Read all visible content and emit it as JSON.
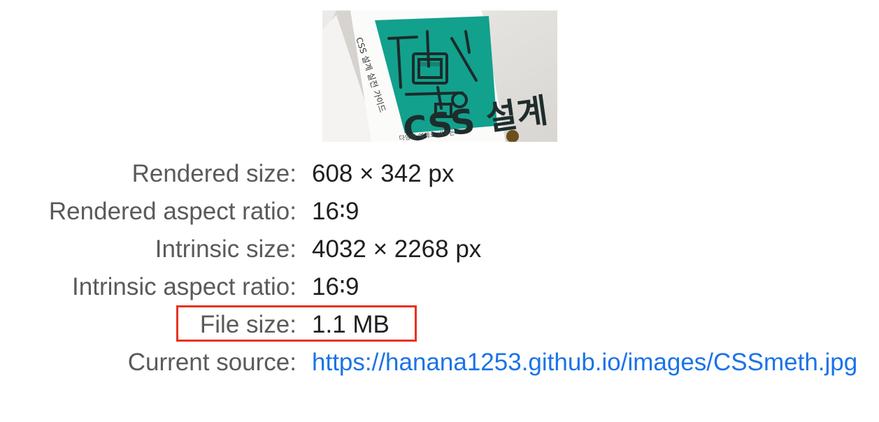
{
  "image_preview": {
    "cover_small_text": "다양한 예제로 배우는",
    "cover_title": "CSS 설계",
    "spine_text": "CSS 설계 실전 가이드"
  },
  "properties": [
    {
      "label": "Rendered size:",
      "value": "608 × 342 px"
    },
    {
      "label": "Rendered aspect ratio:",
      "value": "16∶9"
    },
    {
      "label": "Intrinsic size:",
      "value": "4032 × 2268 px"
    },
    {
      "label": "Intrinsic aspect ratio:",
      "value": "16∶9"
    },
    {
      "label": "File size:",
      "value": "1.1 MB"
    },
    {
      "label": "Current source:",
      "value": "https://hanana1253.github.io/images/CSSmeth.jpg"
    }
  ],
  "colors": {
    "highlight_border": "#e8321f",
    "link": "#1a73e8",
    "label_text": "#5a5a5a",
    "value_text": "#1f1f1f",
    "book_teal": "#12a18d"
  }
}
